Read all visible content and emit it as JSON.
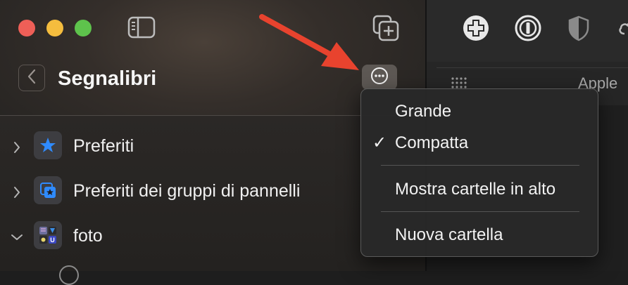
{
  "window": {
    "buttons": [
      "close",
      "minimize",
      "zoom"
    ]
  },
  "sidebar": {
    "title": "Segnalibri",
    "items": [
      {
        "label": "Preferiti",
        "icon": "star-icon",
        "expanded": false
      },
      {
        "label": "Preferiti dei gruppi di pannelli",
        "icon": "tab-group-favorites-icon",
        "expanded": false
      },
      {
        "label": "foto",
        "icon": "folder-thumbnails-icon",
        "expanded": true
      }
    ]
  },
  "menu": {
    "items": [
      {
        "label": "Grande",
        "checked": false
      },
      {
        "label": "Compatta",
        "checked": true
      },
      {
        "label": "Mostra cartelle in alto",
        "checked": false
      },
      {
        "label": "Nuova cartella",
        "checked": false
      }
    ],
    "check_glyph": "✓"
  },
  "tabs": {
    "partial_tab": "Apple"
  },
  "colors": {
    "annotation_arrow": "#e8432e",
    "star": "#2f8bff",
    "menu_bg": "#282828"
  }
}
